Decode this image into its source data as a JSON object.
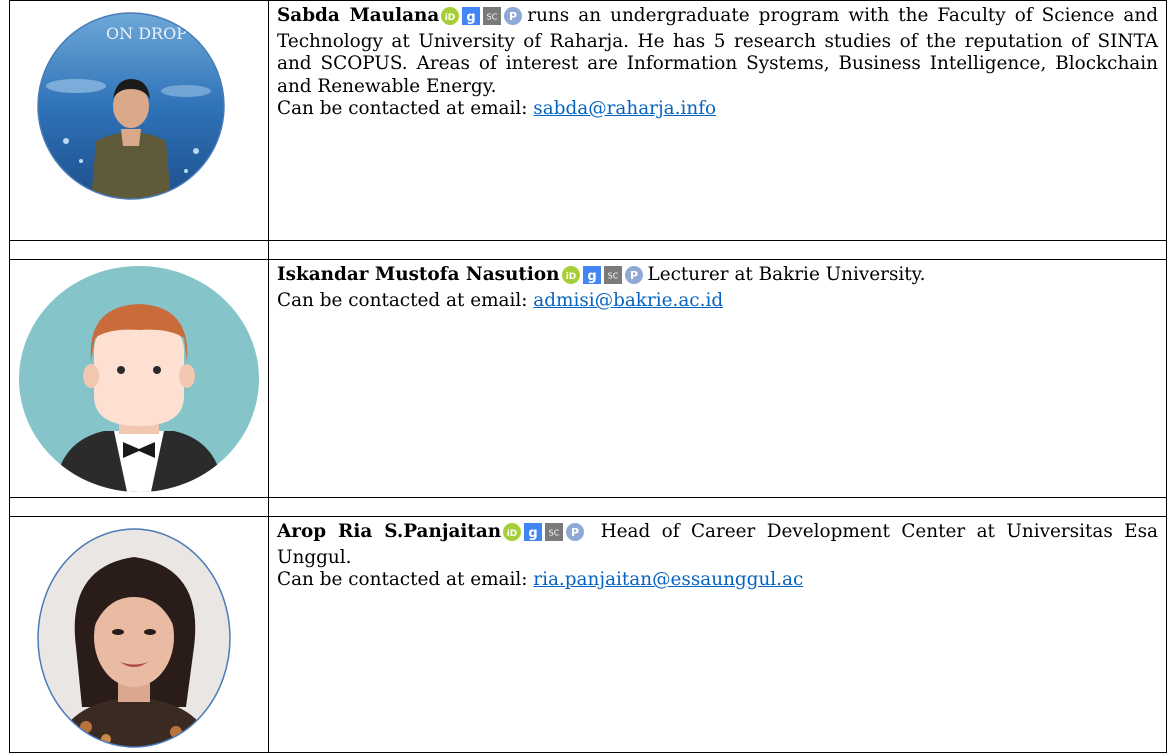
{
  "profiles": [
    {
      "name": "Sabda Maulana",
      "bio": "runs an undergraduate program with the Faculty of Science and Technology at University of Raharja. He has 5 research studies of the reputation of SINTA and SCOPUS. Areas of interest are Information Systems, Business Intelligence, Blockchain and Renewable Energy.",
      "contact_label": "Can be contacted at email: ",
      "email": "sabda@raharja.info",
      "photo_text": "ON DROP"
    },
    {
      "name": "Iskandar Mustofa Nasution",
      "bio": "Lecturer at Bakrie University.",
      "contact_label": "Can be contacted at email: ",
      "email": "admisi@bakrie.ac.id"
    },
    {
      "name": "Arop Ria S.Panjaitan",
      "bio": " Head of Career Development Center at Universitas Esa Unggul.",
      "contact_label": "Can be contacted at email: ",
      "email": "ria.panjaitan@essaunggul.ac"
    }
  ],
  "icons": {
    "orcid": "iD",
    "scholar": "g",
    "scopus": "SC",
    "publons": "P"
  },
  "colors": {
    "orcid": "#a6ce39",
    "scholar": "#4285f4",
    "scopus": "#7a7a7a",
    "publons": "#8fa9d6",
    "link": "#0563c1",
    "avatar_bg": "#85c5c9"
  }
}
